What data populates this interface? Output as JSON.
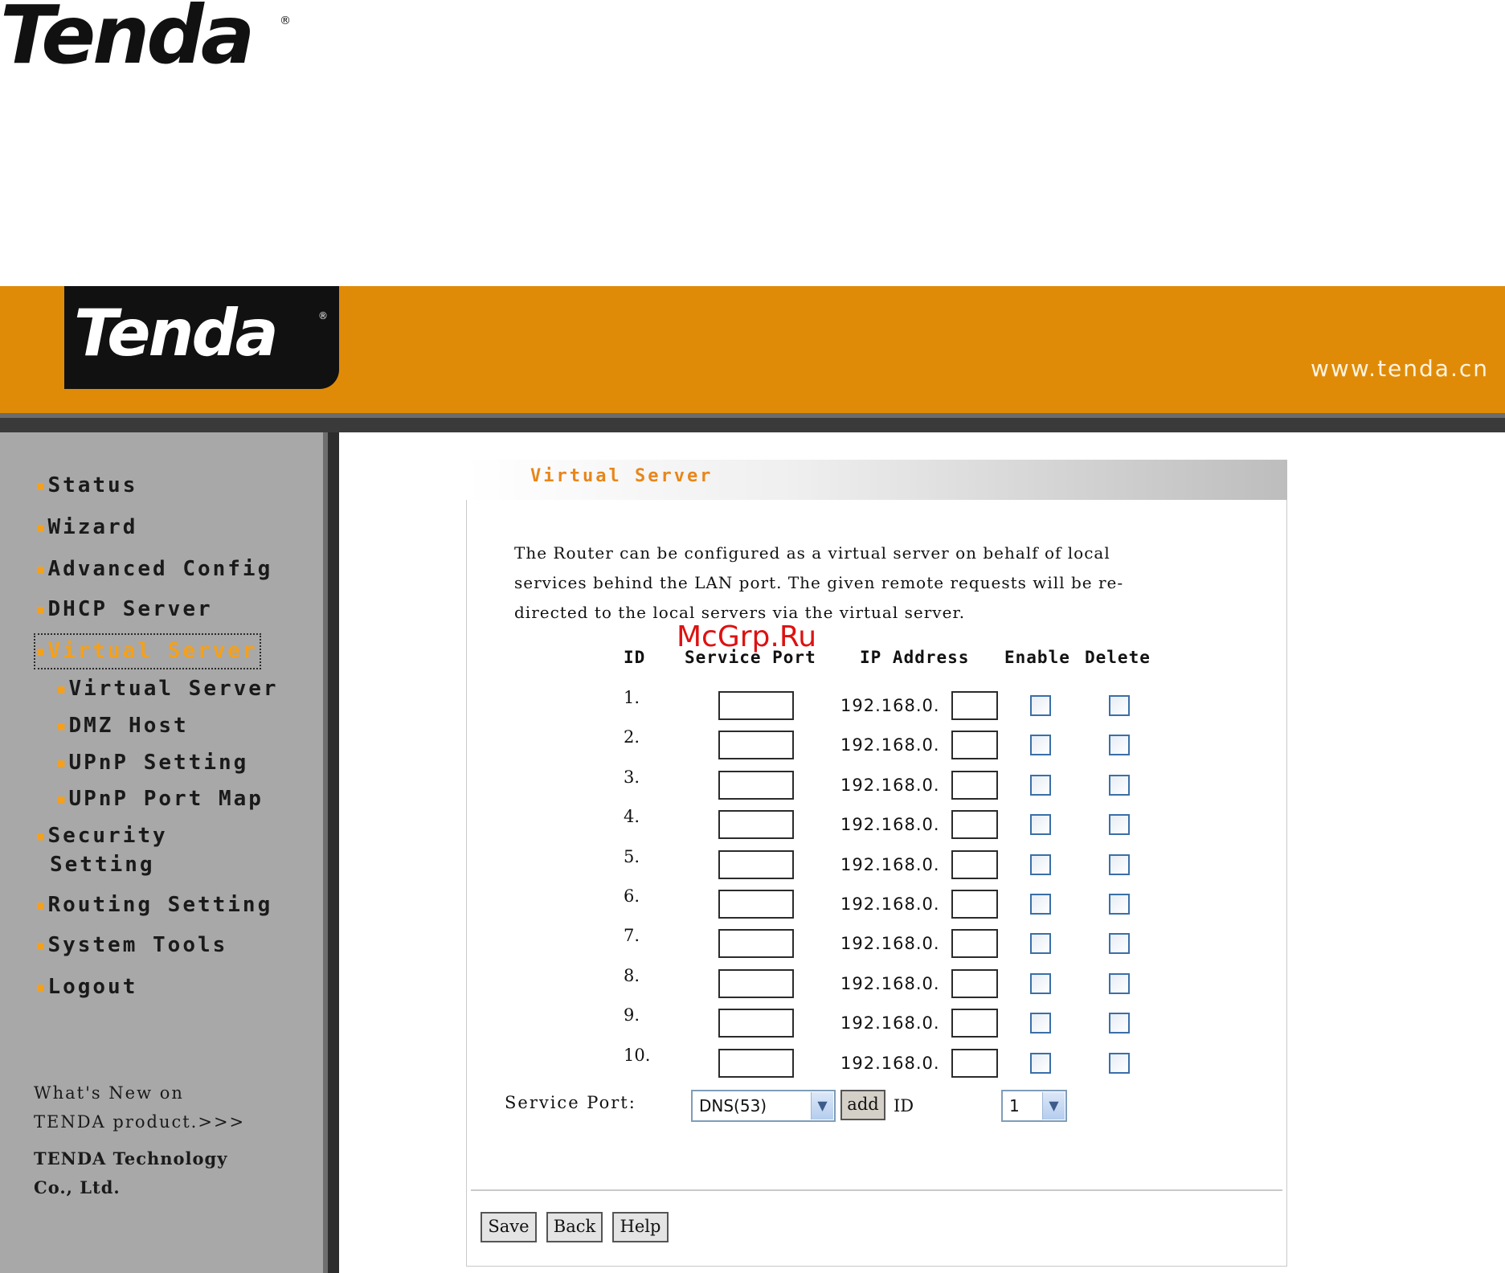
{
  "doc_logo": {
    "text": "Tenda",
    "reg": "®"
  },
  "header": {
    "logo_text": "Tenda",
    "logo_reg": "®",
    "url": "www.tenda.cn"
  },
  "sidebar": {
    "items": [
      {
        "label": "Status"
      },
      {
        "label": "Wizard"
      },
      {
        "label": "Advanced Config"
      },
      {
        "label": "DHCP Server"
      },
      {
        "label": "Virtual Server"
      },
      {
        "label": "Security"
      },
      {
        "label": "Setting"
      },
      {
        "label": "Routing Setting"
      },
      {
        "label": "System Tools"
      },
      {
        "label": "Logout"
      }
    ],
    "subitems": [
      {
        "label": "Virtual Server"
      },
      {
        "label": "DMZ Host"
      },
      {
        "label": "UPnP Setting"
      },
      {
        "label": "UPnP Port Map"
      }
    ],
    "whats_new_line1": "What's New on",
    "whats_new_line2": "TENDA product.>>>",
    "company_line1": "TENDA Technology",
    "company_line2": "Co., Ltd."
  },
  "main": {
    "title": "Virtual Server",
    "description": "The Router can be configured as a virtual server on behalf of local services behind the LAN port. The given remote requests will be re-directed to the local servers via the virtual server.",
    "columns": {
      "id": "ID",
      "service_port": "Service Port",
      "ip_address": "IP Address",
      "enable": "Enable",
      "delete": "Delete"
    },
    "ip_prefix": "192.168.0.",
    "rows": [
      {
        "id": "1."
      },
      {
        "id": "2."
      },
      {
        "id": "3."
      },
      {
        "id": "4."
      },
      {
        "id": "5."
      },
      {
        "id": "6."
      },
      {
        "id": "7."
      },
      {
        "id": "8."
      },
      {
        "id": "9."
      },
      {
        "id": "10."
      }
    ],
    "service_port_label": "Service Port:",
    "service_port_selected": "DNS(53)",
    "add_label": "add",
    "id_label": "ID",
    "id_selected": "1",
    "buttons": {
      "save": "Save",
      "back": "Back",
      "help": "Help"
    }
  },
  "watermark": "McGrp.Ru",
  "colors": {
    "header": "#e08b08",
    "accent": "#f5a01a",
    "sidebar": "#a8a8a8"
  }
}
